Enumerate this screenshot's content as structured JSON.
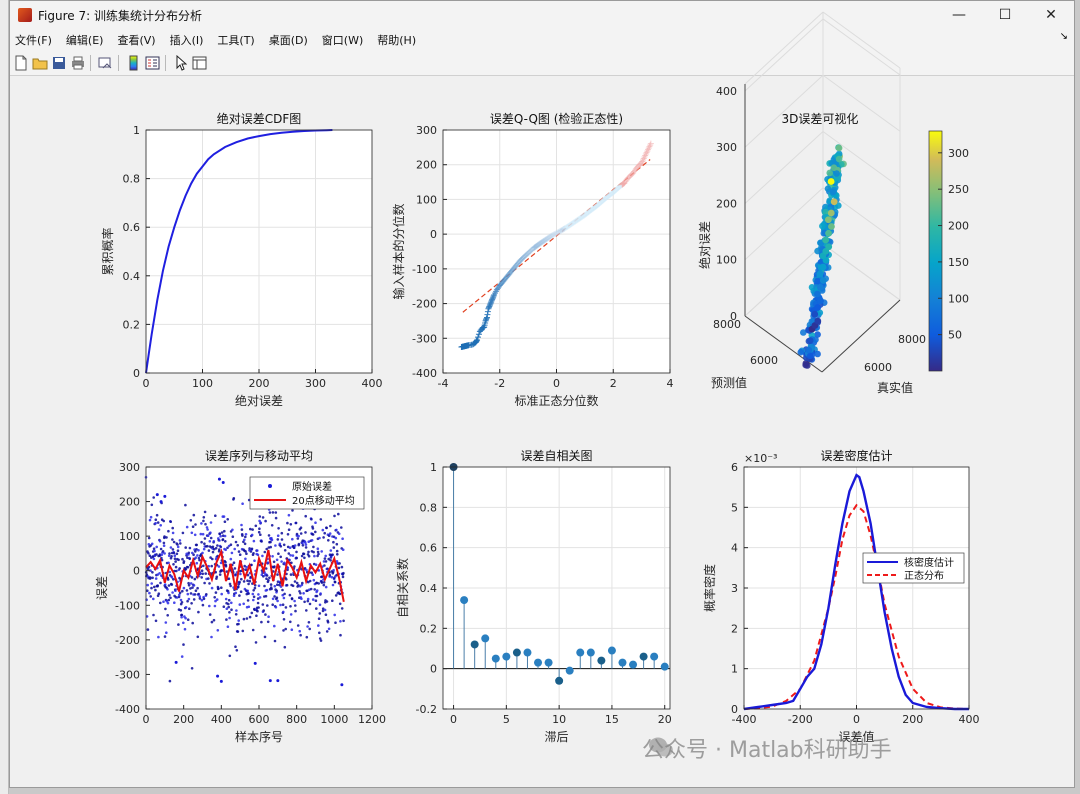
{
  "window": {
    "title": "Figure 7: 训练集统计分布分析",
    "minimize": "—",
    "maximize": "☐",
    "close": "✕"
  },
  "menu": {
    "items": [
      "文件(F)",
      "编辑(E)",
      "查看(V)",
      "插入(I)",
      "工具(T)",
      "桌面(D)",
      "窗口(W)",
      "帮助(H)"
    ],
    "dock": "↘"
  },
  "toolbar": {
    "icons": [
      "new-figure-icon",
      "open-file-icon",
      "save-icon",
      "print-icon",
      "link-plot-icon",
      "insert-colorbar-icon",
      "insert-legend-icon",
      "edit-plot-icon",
      "property-inspector-icon"
    ]
  },
  "watermark": {
    "text": "公众号 · Matlab科研助手"
  },
  "chart_data": [
    {
      "type": "line",
      "title": "绝对误差CDF图",
      "xlabel": "绝对误差",
      "ylabel": "累积概率",
      "xlim": [
        0,
        400
      ],
      "ylim": [
        0,
        1
      ],
      "xticks": [
        0,
        100,
        200,
        300,
        400
      ],
      "yticks": [
        0,
        0.2,
        0.4,
        0.6,
        0.8,
        1
      ],
      "grid": true,
      "color": "#1f1fe0",
      "x": [
        0,
        5,
        10,
        20,
        30,
        40,
        50,
        60,
        70,
        80,
        90,
        100,
        110,
        120,
        140,
        160,
        180,
        200,
        220,
        240,
        260,
        280,
        300,
        320,
        330
      ],
      "y": [
        0,
        0.08,
        0.16,
        0.3,
        0.42,
        0.52,
        0.6,
        0.67,
        0.73,
        0.78,
        0.82,
        0.85,
        0.88,
        0.9,
        0.93,
        0.95,
        0.965,
        0.975,
        0.983,
        0.989,
        0.993,
        0.996,
        0.998,
        0.999,
        1
      ]
    },
    {
      "type": "scatter",
      "title": "误差Q-Q图 (检验正态性)",
      "xlabel": "标准正态分位数",
      "ylabel": "输入样本的分位数",
      "xlim": [
        -4,
        4
      ],
      "ylim": [
        -400,
        300
      ],
      "xticks": [
        -4,
        -2,
        0,
        2,
        4
      ],
      "yticks": [
        -400,
        -300,
        -200,
        -100,
        0,
        100,
        200,
        300
      ],
      "grid": true,
      "reference_line": {
        "x": [
          -3.3,
          3.3
        ],
        "y": [
          -225,
          215
        ],
        "color": "#e04020"
      },
      "points": {
        "marker": "+",
        "x": [
          -3.35,
          -3.1,
          -2.95,
          -2.85,
          -2.8,
          -2.7,
          -2.6,
          -2.55,
          -2.5,
          -2.45,
          -2.4,
          -2.35,
          -2.3,
          -2.25,
          -2.2,
          -2.1,
          -2.0,
          -1.9,
          -1.8,
          -1.7,
          -1.6,
          -1.5,
          -1.4,
          -1.3,
          -1.2,
          -1.1,
          -1.0,
          -0.9,
          -0.8,
          -0.6,
          -0.4,
          -0.2,
          0.0,
          0.2,
          0.4,
          0.6,
          0.8,
          1.0,
          1.2,
          1.4,
          1.6,
          1.8,
          2.0,
          2.2,
          2.4,
          2.5,
          2.6,
          2.7,
          2.8,
          2.9,
          3.0,
          3.35
        ],
        "y": [
          -325,
          -320,
          -318,
          -312,
          -305,
          -280,
          -270,
          -268,
          -250,
          -240,
          -215,
          -205,
          -195,
          -185,
          -175,
          -160,
          -148,
          -138,
          -128,
          -118,
          -108,
          -98,
          -88,
          -78,
          -70,
          -62,
          -55,
          -47,
          -40,
          -28,
          -17,
          -6,
          3,
          12,
          22,
          33,
          44,
          55,
          68,
          80,
          94,
          108,
          120,
          135,
          148,
          160,
          168,
          176,
          188,
          198,
          205,
          265
        ]
      }
    },
    {
      "type": "scatter3d",
      "title": "3D误差可视化",
      "xlabel": "真实值",
      "ylabel": "预测值",
      "zlabel": "绝对误差",
      "xticks": [
        6000,
        8000
      ],
      "yticks": [
        6000,
        8000
      ],
      "zticks": [
        0,
        100,
        200,
        300,
        400
      ],
      "colorbar": {
        "ticks": [
          50,
          100,
          150,
          200,
          250,
          300
        ],
        "range": [
          0,
          330
        ],
        "colormap": "parula"
      },
      "z_values": [
        2,
        10,
        20,
        35,
        50,
        65,
        80,
        95,
        110,
        125,
        140,
        155,
        165,
        175,
        185,
        200,
        215,
        230,
        245,
        260,
        285,
        330
      ]
    },
    {
      "type": "line",
      "title": "误差序列与移动平均",
      "xlabel": "样本序号",
      "ylabel": "误差",
      "xlim": [
        0,
        1200
      ],
      "ylim": [
        -400,
        300
      ],
      "xticks": [
        0,
        200,
        400,
        600,
        800,
        1000,
        1200
      ],
      "yticks": [
        -400,
        -300,
        -200,
        -100,
        0,
        100,
        200,
        300
      ],
      "legend": {
        "position": "top-right",
        "entries": [
          "原始误差",
          "20点移动平均"
        ]
      },
      "series": [
        {
          "name": "原始误差",
          "style": "dots",
          "color": "#1a1ad8",
          "n_points": 1050,
          "spread": 110,
          "outliers": [
            {
              "x": 60,
              "y": 220
            },
            {
              "x": 80,
              "y": 200
            },
            {
              "x": 100,
              "y": 215
            },
            {
              "x": 390,
              "y": 265
            },
            {
              "x": 410,
              "y": 255
            },
            {
              "x": 380,
              "y": -305
            },
            {
              "x": 400,
              "y": -320
            },
            {
              "x": 650,
              "y": 210
            },
            {
              "x": 660,
              "y": -318
            },
            {
              "x": 700,
              "y": -318
            },
            {
              "x": 1040,
              "y": -330
            },
            {
              "x": 160,
              "y": -265
            },
            {
              "x": 580,
              "y": -268
            }
          ]
        },
        {
          "name": "20点移动平均",
          "style": "line",
          "color": "#e81010",
          "x": [
            0,
            25,
            50,
            75,
            100,
            125,
            150,
            175,
            200,
            225,
            250,
            275,
            300,
            325,
            350,
            375,
            400,
            425,
            450,
            475,
            500,
            525,
            550,
            575,
            600,
            625,
            650,
            675,
            700,
            725,
            750,
            775,
            800,
            825,
            850,
            875,
            900,
            925,
            950,
            975,
            1000,
            1025,
            1050
          ],
          "y": [
            10,
            25,
            5,
            30,
            -35,
            15,
            -10,
            -60,
            0,
            -20,
            30,
            -15,
            40,
            10,
            -25,
            25,
            55,
            -30,
            20,
            -55,
            30,
            -20,
            15,
            -40,
            35,
            0,
            60,
            -30,
            20,
            -45,
            30,
            10,
            -20,
            25,
            -30,
            15,
            -5,
            20,
            -25,
            5,
            35,
            -20,
            -90
          ]
        }
      ]
    },
    {
      "type": "stem",
      "title": "误差自相关图",
      "xlabel": "滞后",
      "ylabel": "自相关系数",
      "xlim": [
        -1,
        20.5
      ],
      "ylim": [
        -0.2,
        1
      ],
      "xticks": [
        0,
        5,
        10,
        15,
        20
      ],
      "yticks": [
        -0.2,
        0,
        0.2,
        0.4,
        0.6,
        0.8,
        1
      ],
      "grid": true,
      "lags": [
        0,
        1,
        2,
        3,
        4,
        5,
        6,
        7,
        8,
        9,
        10,
        11,
        12,
        13,
        14,
        15,
        16,
        17,
        18,
        19,
        20
      ],
      "values": [
        1.0,
        0.34,
        0.12,
        0.15,
        0.05,
        0.06,
        0.08,
        0.08,
        0.03,
        0.03,
        -0.06,
        -0.01,
        0.08,
        0.08,
        0.04,
        0.09,
        0.03,
        0.02,
        0.06,
        0.06,
        0.01
      ]
    },
    {
      "type": "line",
      "title": "误差密度估计",
      "xlabel": "误差值",
      "ylabel": "概率密度",
      "exponent_label": "×10⁻³",
      "xlim": [
        -400,
        400
      ],
      "ylim": [
        0,
        6
      ],
      "xticks": [
        -400,
        -200,
        0,
        200,
        400
      ],
      "yticks": [
        0,
        1,
        2,
        3,
        4,
        5,
        6
      ],
      "grid": true,
      "legend": {
        "position": "right",
        "entries": [
          "核密度估计",
          "正态分布"
        ]
      },
      "series": [
        {
          "name": "核密度估计",
          "color": "#1a1ad8",
          "dash": "solid",
          "x": [
            -400,
            -350,
            -300,
            -250,
            -225,
            -200,
            -175,
            -150,
            -125,
            -100,
            -75,
            -50,
            -25,
            0,
            10,
            25,
            50,
            75,
            100,
            125,
            150,
            175,
            200,
            225,
            250,
            300,
            350,
            400
          ],
          "y": [
            0,
            0.05,
            0.1,
            0.15,
            0.2,
            0.5,
            0.8,
            1.0,
            1.6,
            2.5,
            3.6,
            4.6,
            5.4,
            5.8,
            5.75,
            5.4,
            4.6,
            3.5,
            2.4,
            1.5,
            0.8,
            0.35,
            0.15,
            0.1,
            0.05,
            0.02,
            0,
            0
          ]
        },
        {
          "name": "正态分布",
          "color": "#ee1a1a",
          "dash": "dashed",
          "x": [
            -400,
            -350,
            -300,
            -250,
            -200,
            -150,
            -100,
            -75,
            -50,
            -25,
            0,
            25,
            50,
            75,
            100,
            150,
            200,
            250,
            300,
            350,
            400
          ],
          "y": [
            0,
            0.02,
            0.06,
            0.2,
            0.5,
            1.2,
            2.5,
            3.3,
            4.2,
            4.8,
            5.05,
            4.9,
            4.3,
            3.5,
            2.6,
            1.3,
            0.5,
            0.15,
            0.04,
            0.01,
            0
          ]
        }
      ]
    }
  ]
}
